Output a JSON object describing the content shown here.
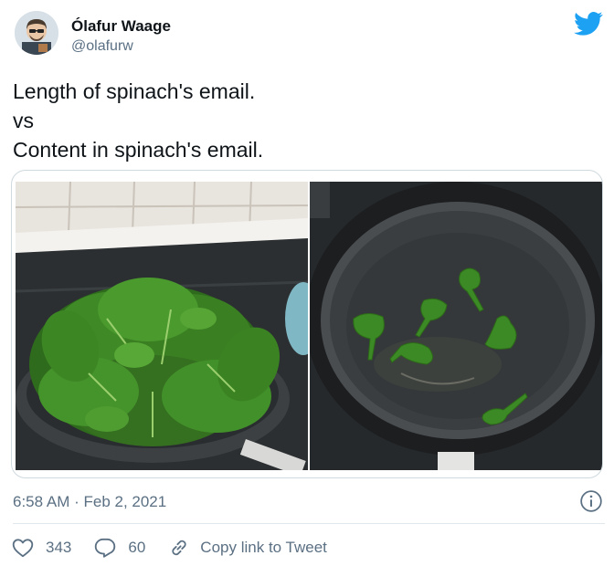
{
  "author": {
    "name": "Ólafur Waage",
    "handle": "@olafurw"
  },
  "tweet": {
    "lines": [
      "Length of spinach's email.",
      "vs",
      "Content in spinach's email."
    ],
    "timestamp": "6:58 AM · Feb 2, 2021"
  },
  "media": {
    "images": [
      {
        "description_icon": "photo-full-pan-of-spinach"
      },
      {
        "description_icon": "photo-wilted-spinach-in-pan"
      }
    ]
  },
  "actions": {
    "like_count": "343",
    "reply_count": "60",
    "copy_link_label": "Copy link to Tweet"
  },
  "colors": {
    "twitter_blue": "#1da1f2",
    "secondary_text": "#5b7083",
    "border": "#cfd9de"
  },
  "icons": [
    "twitter-logo-icon",
    "info-icon",
    "heart-icon",
    "reply-icon",
    "link-icon"
  ]
}
